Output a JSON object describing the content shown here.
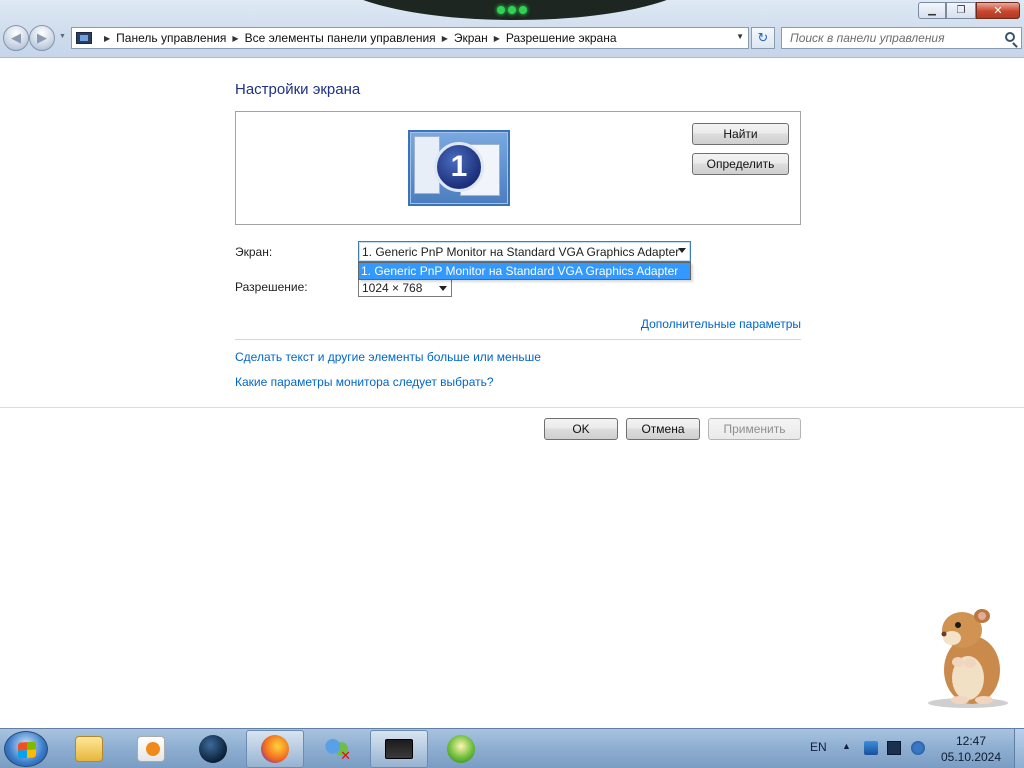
{
  "window": {
    "minimize_glyph": "▁",
    "maximize_glyph": "❐",
    "close_glyph": "✕"
  },
  "nav": {
    "back_glyph": "◀",
    "forward_glyph": "▶",
    "breadcrumb": [
      "Панель управления",
      "Все элементы панели управления",
      "Экран",
      "Разрешение экрана"
    ],
    "crumb_separator": "▶",
    "refresh_glyph": "↻",
    "search_placeholder": "Поиск в панели управления"
  },
  "content": {
    "title": "Настройки экрана",
    "monitor_number": "1",
    "find_button": "Найти",
    "identify_button": "Определить",
    "screen_label": "Экран:",
    "screen_value": "1. Generic PnP Monitor на Standard VGA Graphics Adapter",
    "screen_options": [
      "1. Generic PnP Monitor на Standard VGA Graphics Adapter"
    ],
    "resolution_label": "Разрешение:",
    "resolution_value": "1024 × 768",
    "advanced_link": "Дополнительные параметры",
    "text_size_link": "Сделать текст и другие элементы больше или меньше",
    "which_settings_link": "Какие параметры монитора следует выбрать?",
    "ok_button": "OK",
    "cancel_button": "Отмена",
    "apply_button": "Применить"
  },
  "taskbar": {
    "items": [
      "start",
      "explorer",
      "media-player",
      "app-globe",
      "firefox",
      "users",
      "display-settings",
      "windows-media"
    ],
    "active_items": [
      "firefox",
      "display-settings"
    ],
    "lang": "EN",
    "time": "12:47",
    "date": "05.10.2024"
  },
  "colors": {
    "title": "#1e3287",
    "link": "#0066cc",
    "selection": "#3399ff"
  }
}
